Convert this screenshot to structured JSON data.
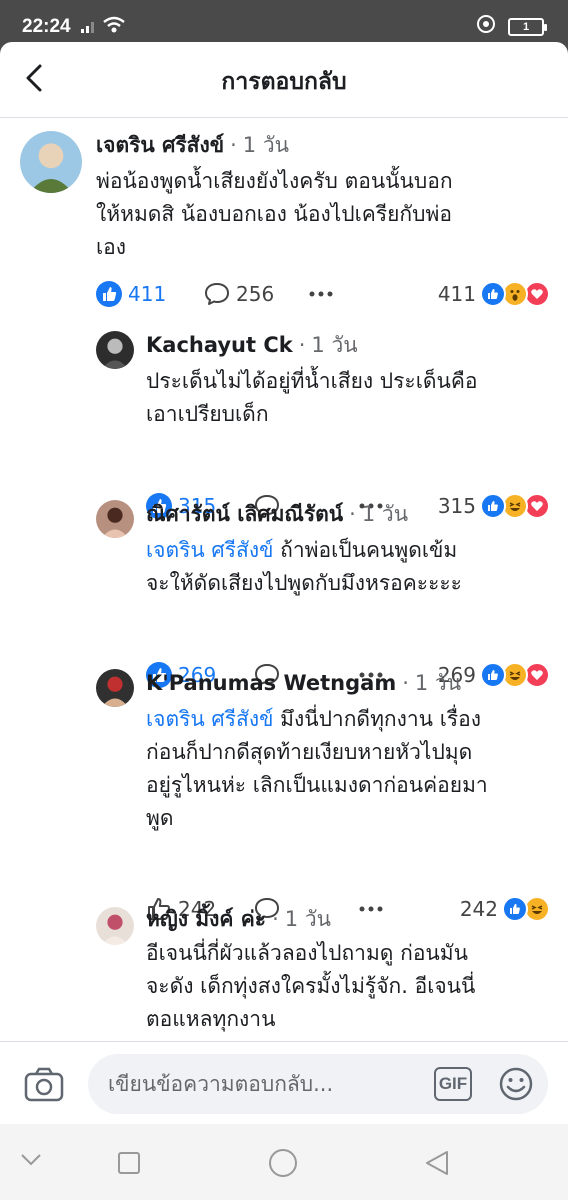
{
  "status_bar": {
    "time": "22:24",
    "battery": "1"
  },
  "header": {
    "title": "การตอบกลับ"
  },
  "comments": [
    {
      "name": "เจตริน ศรีสังข์",
      "time": "1 วัน",
      "mention": "",
      "lines": [
        "พ่อน้องพูดน้ำเสียงยังไงครับ ตอนนั้นบอก",
        "ให้หมดสิ น้องบอกเอง น้องไปเครียกับพ่อ",
        "เอง"
      ],
      "likes": "411",
      "replies": "256",
      "reaction_total": "411",
      "reactions": [
        "like",
        "wow",
        "love"
      ],
      "liked": true
    },
    {
      "name": "Kachayut Ck",
      "time": "1 วัน",
      "mention": "",
      "lines": [
        "ประเด็นไม่ได้อยู่ที่น้ำเสียง ประเด็นคือ",
        "เอาเปรียบเด็ก"
      ],
      "likes": "315",
      "replies": "",
      "reaction_total": "315",
      "reactions": [
        "like",
        "haha",
        "love"
      ],
      "liked": true
    },
    {
      "name": "ณิศารัตน์ เลิศมณีรัตน์",
      "time": "1 วัน",
      "mention": "เจตริน ศรีสังข์",
      "lines": [
        " ถ้าพ่อเป็นคนพูดเข้ม",
        "จะให้ดัดเสียงไปพูดกับมึงหรอคะะะะ"
      ],
      "likes": "269",
      "replies": "",
      "reaction_total": "269",
      "reactions": [
        "like",
        "haha",
        "love"
      ],
      "liked": true
    },
    {
      "name": "K'Panumas Wetngam",
      "time": "1 วัน",
      "mention": "เจตริน ศรีสังข์",
      "lines": [
        " มึงนี่ปากดีทุกงาน เรื่อง",
        "ก่อนก็ปากดีสุดท้ายเงียบหายหัวไปมุด",
        "อยู่รูไหนห่ะ เลิกเป็นแมงดาก่อนค่อยมา",
        "พูด"
      ],
      "likes": "242",
      "replies": "",
      "reaction_total": "242",
      "reactions": [
        "like",
        "haha"
      ],
      "liked": false
    },
    {
      "name": "หญิง มิ้งค์ ค่ะ",
      "time": "1 วัน",
      "mention": "",
      "lines": [
        "อีเจนนี่กี่ผัวแล้วลองไปถามดู ก่อนมัน",
        "จะดัง เด็กทุ่งสงใครมั้งไม่รู้จัก. อีเจนนี่",
        "ตอแหลทุกงาน"
      ],
      "likes": "",
      "replies": "",
      "reaction_total": "",
      "reactions": [],
      "liked": false
    }
  ],
  "composer": {
    "placeholder": "เขียนข้อความตอบกลับ...",
    "gif_label": "GIF"
  },
  "colors": {
    "accent": "#1877f2",
    "wow": "#f7b125",
    "love": "#f33e58"
  }
}
